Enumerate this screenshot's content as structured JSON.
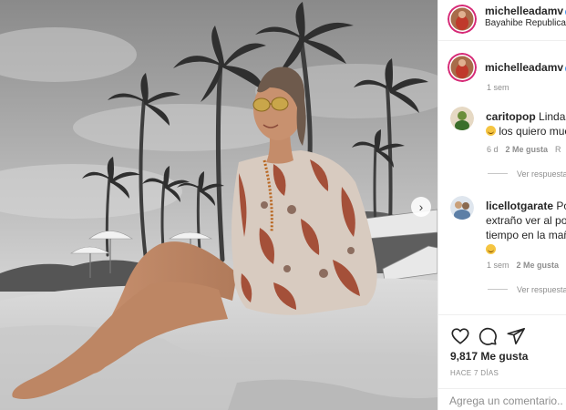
{
  "post": {
    "username": "michelleadamv",
    "location": "Bayahibe Republica Dominicana",
    "likes": "9,817 Me gusta",
    "posted_ago": "HACE 7 DÍAS"
  },
  "caption": {
    "username": "michelleadamv",
    "time": "1 sem"
  },
  "comments": [
    {
      "username": "caritopop",
      "text_line1": "Lindas ver",
      "text_line2": "los quiero muc",
      "time": "6 d",
      "likes": "2 Me gusta",
      "reply": "R"
    },
    {
      "username": "licellotgarate",
      "text_line1": "Por",
      "text_line2": "extraño ver al polo",
      "text_line3": "tiempo en la maña",
      "time": "1 sem",
      "likes": "2 Me gusta",
      "reply": ""
    }
  ],
  "see_replies_label": "Ver respuesta",
  "add_comment_placeholder": "Agrega un comentario...",
  "icons": {
    "like": "heart-icon",
    "comment": "comment-icon",
    "share": "paper-plane-icon",
    "next": "chevron-right-icon",
    "verified": "verified-badge-icon"
  },
  "colors": {
    "verified": "#3897f0",
    "muted_text": "#8e8e8e",
    "border": "#efefef",
    "dress_red": "#9c3b22"
  }
}
